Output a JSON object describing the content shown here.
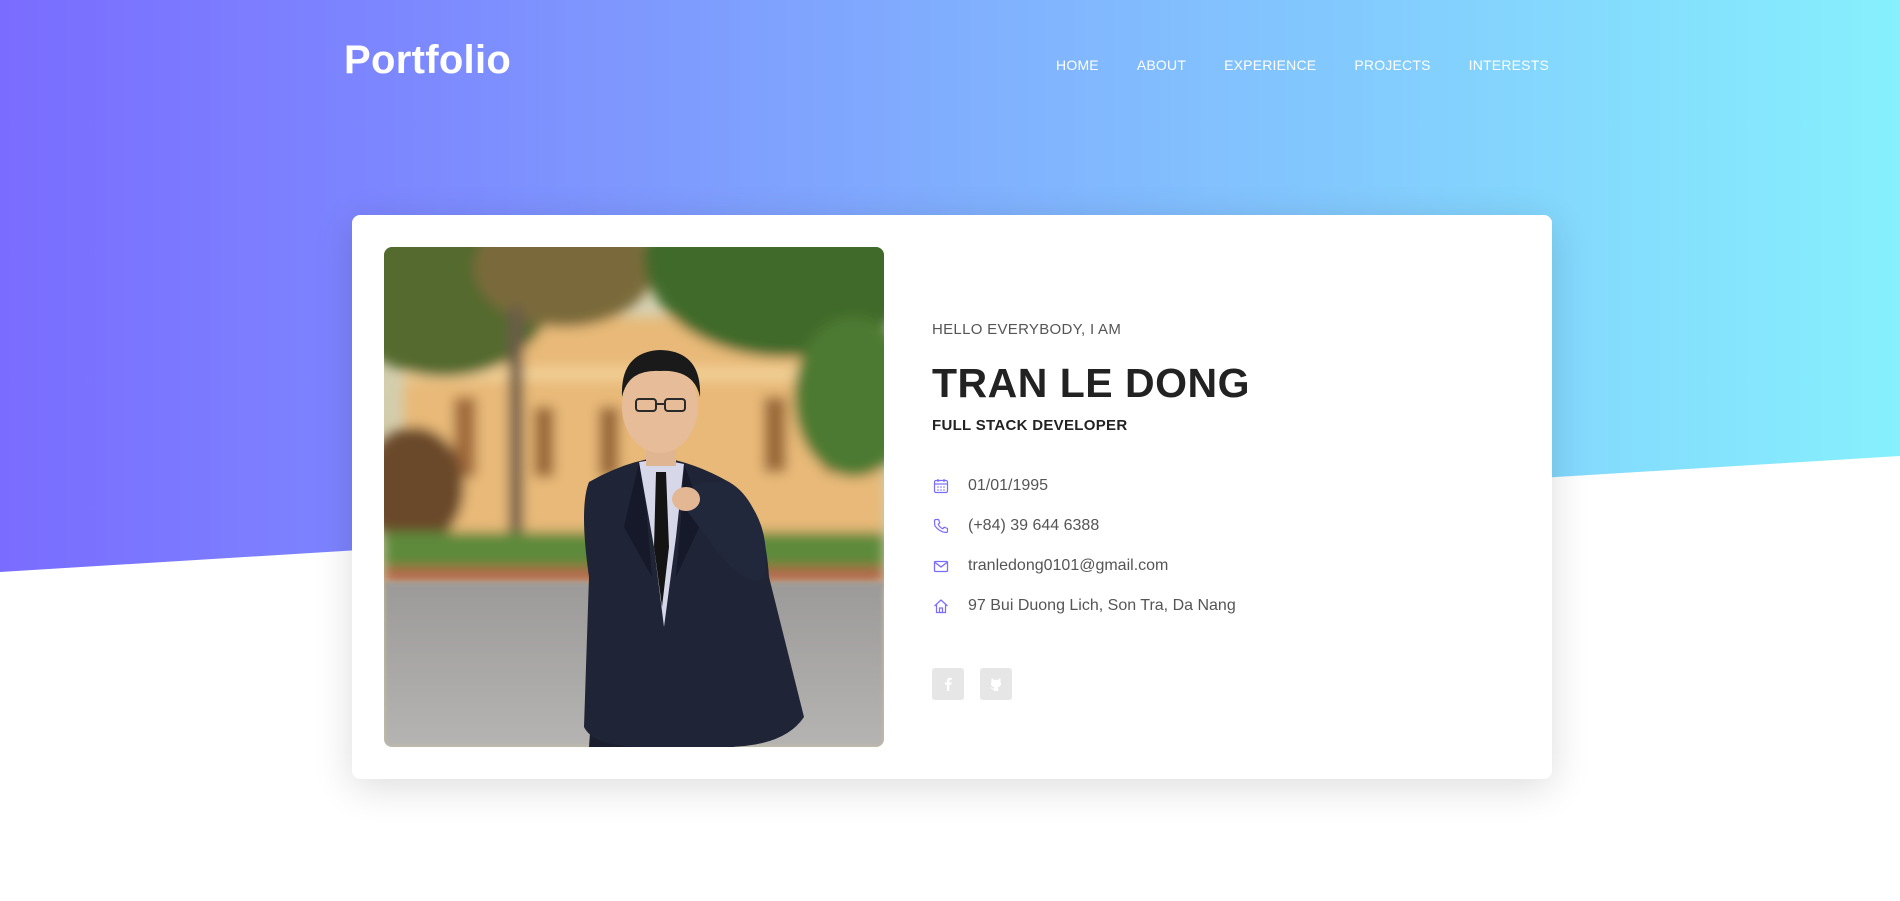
{
  "header": {
    "brand": "Portfolio",
    "nav": [
      "HOME",
      "ABOUT",
      "EXPERIENCE",
      "PROJECTS",
      "INTERESTS"
    ]
  },
  "profile": {
    "greeting": "HELLO EVERYBODY, I AM",
    "name": "TRAN LE DONG",
    "role": "FULL STACK DEVELOPER",
    "contacts": [
      {
        "icon": "calendar-icon",
        "value": "01/01/1995"
      },
      {
        "icon": "phone-icon",
        "value": "(+84) 39 644 6388"
      },
      {
        "icon": "mail-icon",
        "value": "tranledong0101@gmail.com"
      },
      {
        "icon": "home-icon",
        "value": "97 Bui Duong Lich, Son Tra, Da Nang"
      }
    ],
    "socials": [
      "facebook-icon",
      "github-icon"
    ]
  },
  "colors": {
    "gradient_start": "#7a6cff",
    "gradient_end": "#86f0fd",
    "accent": "#7a6cff"
  }
}
